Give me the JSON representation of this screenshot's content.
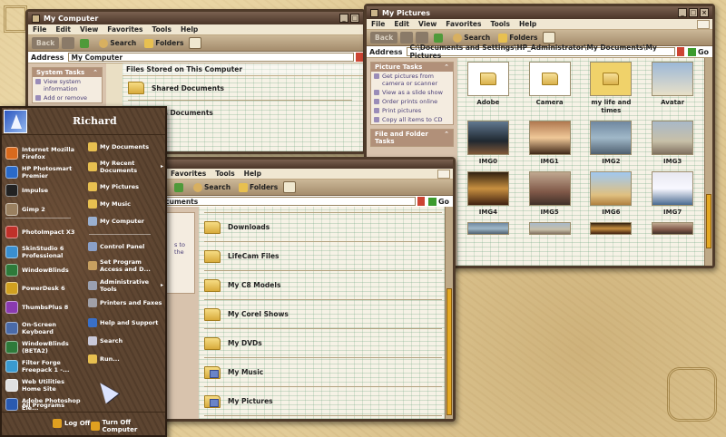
{
  "colors": {
    "desktop": "#e2cc98",
    "window_frame": "#4f3b2a",
    "start_menu_bg": "#5d4531",
    "scroll_thumb": "#e4a923",
    "task_link": "#4a3f78"
  },
  "menu_labels": {
    "file": "File",
    "edit": "Edit",
    "view": "View",
    "favorites": "Favorites",
    "tools": "Tools",
    "help": "Help"
  },
  "toolbar": {
    "back": "Back",
    "search": "Search",
    "folders": "Folders",
    "address": "Address",
    "go": "Go"
  },
  "win_computer": {
    "title": "My Computer",
    "address": "My Computer",
    "system_tasks_header": "System Tasks",
    "system_tasks": [
      "View system information",
      "Add or remove"
    ],
    "section": "Files Stored on This Computer",
    "folders": [
      "Shared Documents",
      "rd's Documents"
    ]
  },
  "win_pictures": {
    "title": "My Pictures",
    "address": "C:\\Documents and Settings\\HP_Administrator\\My Documents\\My Pictures",
    "picture_tasks_header": "Picture Tasks",
    "picture_tasks": [
      "Get pictures from camera or scanner",
      "View as a slide show",
      "Order prints online",
      "Print pictures",
      "Copy all items to CD"
    ],
    "file_folder_tasks_header": "File and Folder Tasks",
    "thumbs": [
      {
        "name": "Adobe",
        "kind": "folder"
      },
      {
        "name": "Camera",
        "kind": "folder"
      },
      {
        "name": "my life and times",
        "kind": "folder"
      },
      {
        "name": "Avatar",
        "kind": "photo"
      },
      {
        "name": "IMG0",
        "kind": "photo"
      },
      {
        "name": "IMG1",
        "kind": "photo"
      },
      {
        "name": "IMG2",
        "kind": "photo"
      },
      {
        "name": "IMG3",
        "kind": "photo"
      },
      {
        "name": "IMG4",
        "kind": "photo"
      },
      {
        "name": "IMG5",
        "kind": "photo"
      },
      {
        "name": "IMG6",
        "kind": "photo"
      },
      {
        "name": "IMG7",
        "kind": "photo"
      }
    ]
  },
  "win_docs": {
    "address_partial": "ocuments",
    "left_text": "s to the",
    "folders": [
      "Downloads",
      "LifeCam Files",
      "My C8 Models",
      "My Corel Shows",
      "My DVDs",
      "My Music",
      "My Pictures"
    ]
  },
  "start_menu": {
    "user": "Richard",
    "programs": [
      {
        "label": "Internet Mozilla Firefox",
        "icon": "firefox-icon",
        "color": "#d86a1e"
      },
      {
        "label": "HP Photosmart Premier",
        "icon": "photosmart-icon",
        "color": "#2a6ac8"
      },
      {
        "label": "Impulse",
        "icon": "impulse-icon",
        "color": "#222222"
      },
      {
        "label": "Gimp 2",
        "icon": "gimp-icon",
        "color": "#9a8060"
      },
      {
        "label": "PhotoImpact X3",
        "icon": "photoimpact-icon",
        "color": "#c0312a"
      },
      {
        "label": "SkinStudio 6 Professional",
        "icon": "skinstudio-icon",
        "color": "#3a8fd0"
      },
      {
        "label": "WindowBlinds",
        "icon": "windowblinds-icon",
        "color": "#2e7a3a"
      },
      {
        "label": "PowerDesk 6",
        "icon": "powerdesk-icon",
        "color": "#d0a020"
      },
      {
        "label": "ThumbsPlus 8",
        "icon": "thumbsplus-icon",
        "color": "#8a3ab0"
      },
      {
        "label": "On-Screen Keyboard",
        "icon": "keyboard-icon",
        "color": "#4a6aa8"
      },
      {
        "label": "WindowBlinds (BETA2)",
        "icon": "windowblinds-beta-icon",
        "color": "#2e7a3a"
      },
      {
        "label": "Filter Forge Freepack 1 -...",
        "icon": "filterforge-icon",
        "color": "#3a9ad0"
      },
      {
        "label": "Web Utilities Home Site",
        "icon": "web-utilities-icon",
        "color": "#e0e0e0"
      },
      {
        "label": "Adobe Photoshop Ele...",
        "icon": "photoshop-icon",
        "color": "#2a5ab0"
      }
    ],
    "places_top": [
      {
        "label": "My Documents",
        "icon": "my-documents-icon",
        "arrow": false
      },
      {
        "label": "My Recent Documents",
        "icon": "recent-documents-icon",
        "arrow": true
      },
      {
        "label": "My Pictures",
        "icon": "my-pictures-icon",
        "arrow": false
      },
      {
        "label": "My Music",
        "icon": "my-music-icon",
        "arrow": false
      },
      {
        "label": "My Computer",
        "icon": "my-computer-icon",
        "arrow": false
      }
    ],
    "places_bottom": [
      {
        "label": "Control Panel",
        "icon": "control-panel-icon",
        "arrow": false
      },
      {
        "label": "Set Program Access and D...",
        "icon": "program-access-icon",
        "arrow": false
      },
      {
        "label": "Administrative Tools",
        "icon": "admin-tools-icon",
        "arrow": true
      },
      {
        "label": "Printers and Faxes",
        "icon": "printers-icon",
        "arrow": false
      },
      {
        "label": "Help and Support",
        "icon": "help-icon",
        "arrow": false
      },
      {
        "label": "Search",
        "icon": "search-icon",
        "arrow": false
      },
      {
        "label": "Run...",
        "icon": "run-icon",
        "arrow": false
      }
    ],
    "all_programs": "All Programs",
    "log_off": "Log Off",
    "turn_off": "Turn Off Computer"
  }
}
